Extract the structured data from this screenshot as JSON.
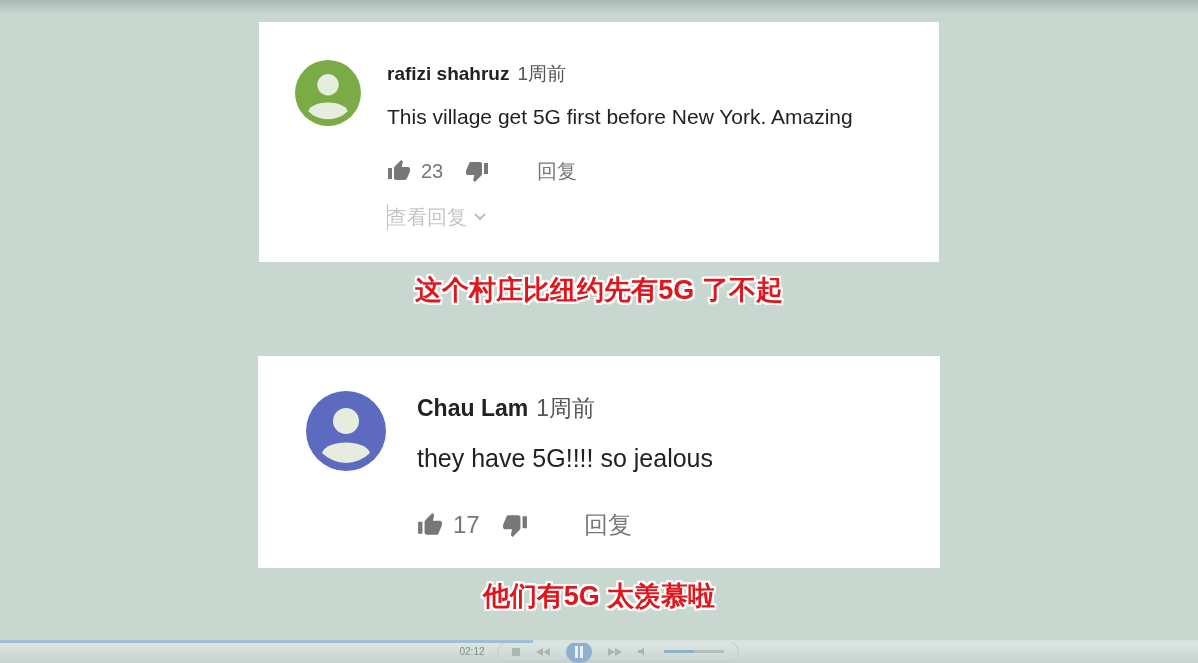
{
  "comments": [
    {
      "author": "rafizi shahruz",
      "time": "1周前",
      "text": "This village get 5G first before New York. Amazing",
      "likes": "23",
      "reply": "回复",
      "view_replies": "查看回复"
    },
    {
      "author": "Chau Lam",
      "time": "1周前",
      "text": "they have 5G!!!! so jealous",
      "likes": "17",
      "reply": "回复"
    }
  ],
  "subtitles": [
    "这个村庄比纽约先有5G 了不起",
    "他们有5G 太羡慕啦"
  ],
  "player": {
    "time": "02:12",
    "progress": {
      "level": 0.445
    },
    "volume": {
      "level": 0.5
    },
    "playing": true
  }
}
